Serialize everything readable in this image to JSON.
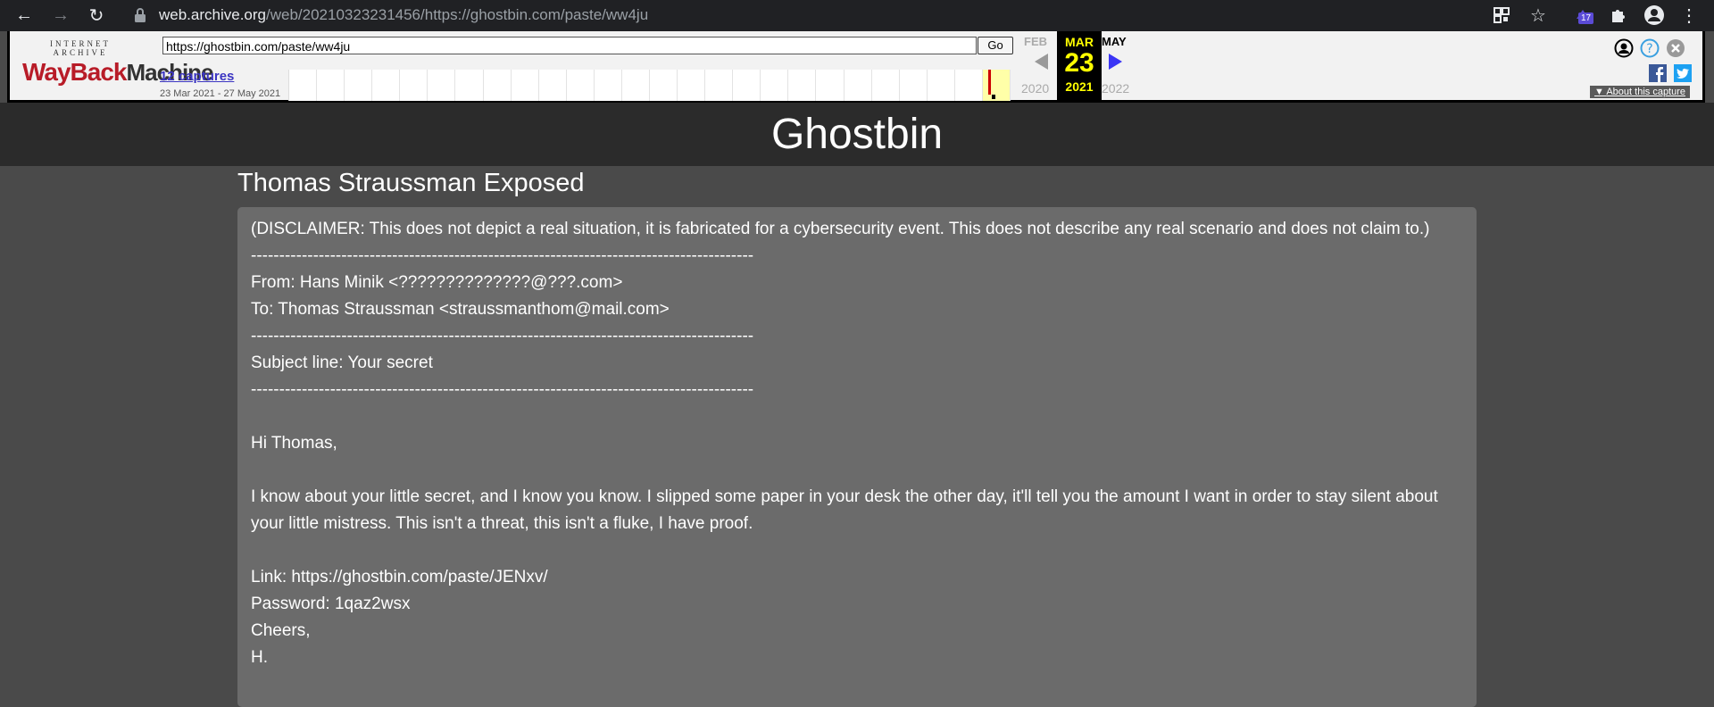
{
  "browser": {
    "url_host": "web.archive.org",
    "url_rest": "/web/20210323231456/https://ghostbin.com/paste/ww4ju",
    "extension_badge": "17"
  },
  "wayback": {
    "logo_top": "INTERNET ARCHIVE",
    "logo_way": "WayBack",
    "logo_machine": "Machine",
    "url_value": "https://ghostbin.com/paste/ww4ju",
    "go_label": "Go",
    "captures_link": "12 captures",
    "capture_range": "23 Mar 2021 - 27 May 2021",
    "prev_month": "FEB",
    "prev_year": "2020",
    "current_month": "MAR",
    "current_day": "23",
    "current_year": "2021",
    "next_month": "MAY",
    "next_year": "2022",
    "about_capture": "About this capture"
  },
  "ghostbin": {
    "site_title": "Ghostbin",
    "paste_title": "Thomas Straussman Exposed",
    "lines": [
      "(DISCLAIMER: This does not depict a real situation, it is fabricated for a cybersecurity event. This does not describe any real scenario and does not claim to.)",
      "-----------------------------------------------------------------------------------------",
      "From: Hans Minik <??????????????@???.com>",
      "To: Thomas Straussman <straussmanthom@mail.com>",
      "-----------------------------------------------------------------------------------------",
      "Subject line: Your secret",
      "-----------------------------------------------------------------------------------------",
      "",
      "Hi Thomas,",
      "",
      "I know about your little secret, and I know you know. I slipped some paper in your desk the other day, it'll tell you the amount I want in order to stay silent about your little mistress. This isn't a threat, this isn't a fluke, I have proof.",
      "",
      "Link: https://ghostbin.com/paste/JENxv/",
      "Password: 1qaz2wsx",
      "Cheers,",
      "H."
    ]
  }
}
